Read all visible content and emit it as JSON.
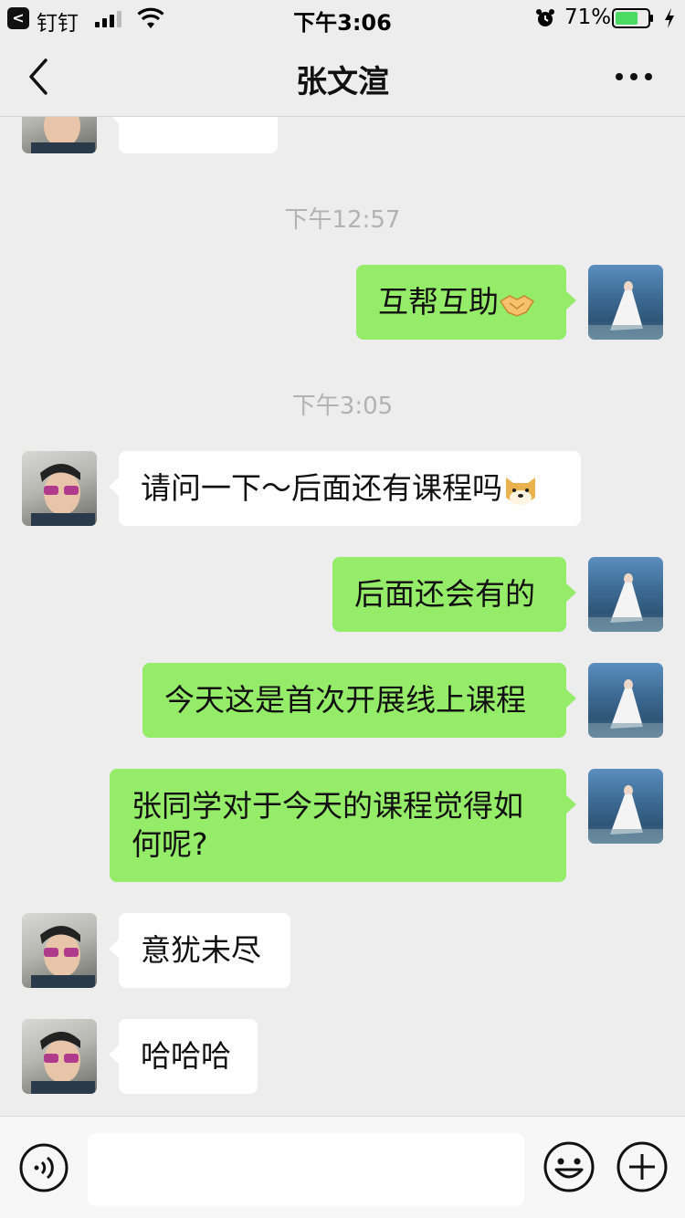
{
  "status_bar": {
    "back_app": "钉钉",
    "time": "下午3:06",
    "battery_percent": "71%",
    "battery_level": 0.71
  },
  "nav": {
    "title": "张文渲",
    "back_icon": "chevron-left-icon",
    "more_icon": "more-dots-icon"
  },
  "messages": [
    {
      "side": "left",
      "text": "",
      "emoji": "thumbs-up-emoji"
    },
    {
      "type": "timestamp",
      "text": "下午12:57"
    },
    {
      "side": "right",
      "text": "互帮互助",
      "emoji": "handshake-emoji"
    },
    {
      "type": "timestamp",
      "text": "下午3:05"
    },
    {
      "side": "left",
      "text": "请问一下～后面还有课程吗",
      "emoji": "dog-emoji"
    },
    {
      "side": "right",
      "text": "后面还会有的"
    },
    {
      "side": "right",
      "text": "今天这是首次开展线上课程"
    },
    {
      "side": "right",
      "lines": [
        "张同学对于今天的课程觉得如",
        "何呢?"
      ]
    },
    {
      "side": "left",
      "text": "意犹未尽"
    },
    {
      "side": "left",
      "text": "哈哈哈"
    }
  ],
  "input_bar": {
    "placeholder": "",
    "voice_icon": "voice-icon",
    "emoji_icon": "smiley-icon",
    "plus_icon": "plus-icon"
  },
  "colors": {
    "background": "#ededed",
    "outgoing_bubble": "#95ec69",
    "incoming_bubble": "#ffffff",
    "battery_fill": "#4cd964"
  }
}
